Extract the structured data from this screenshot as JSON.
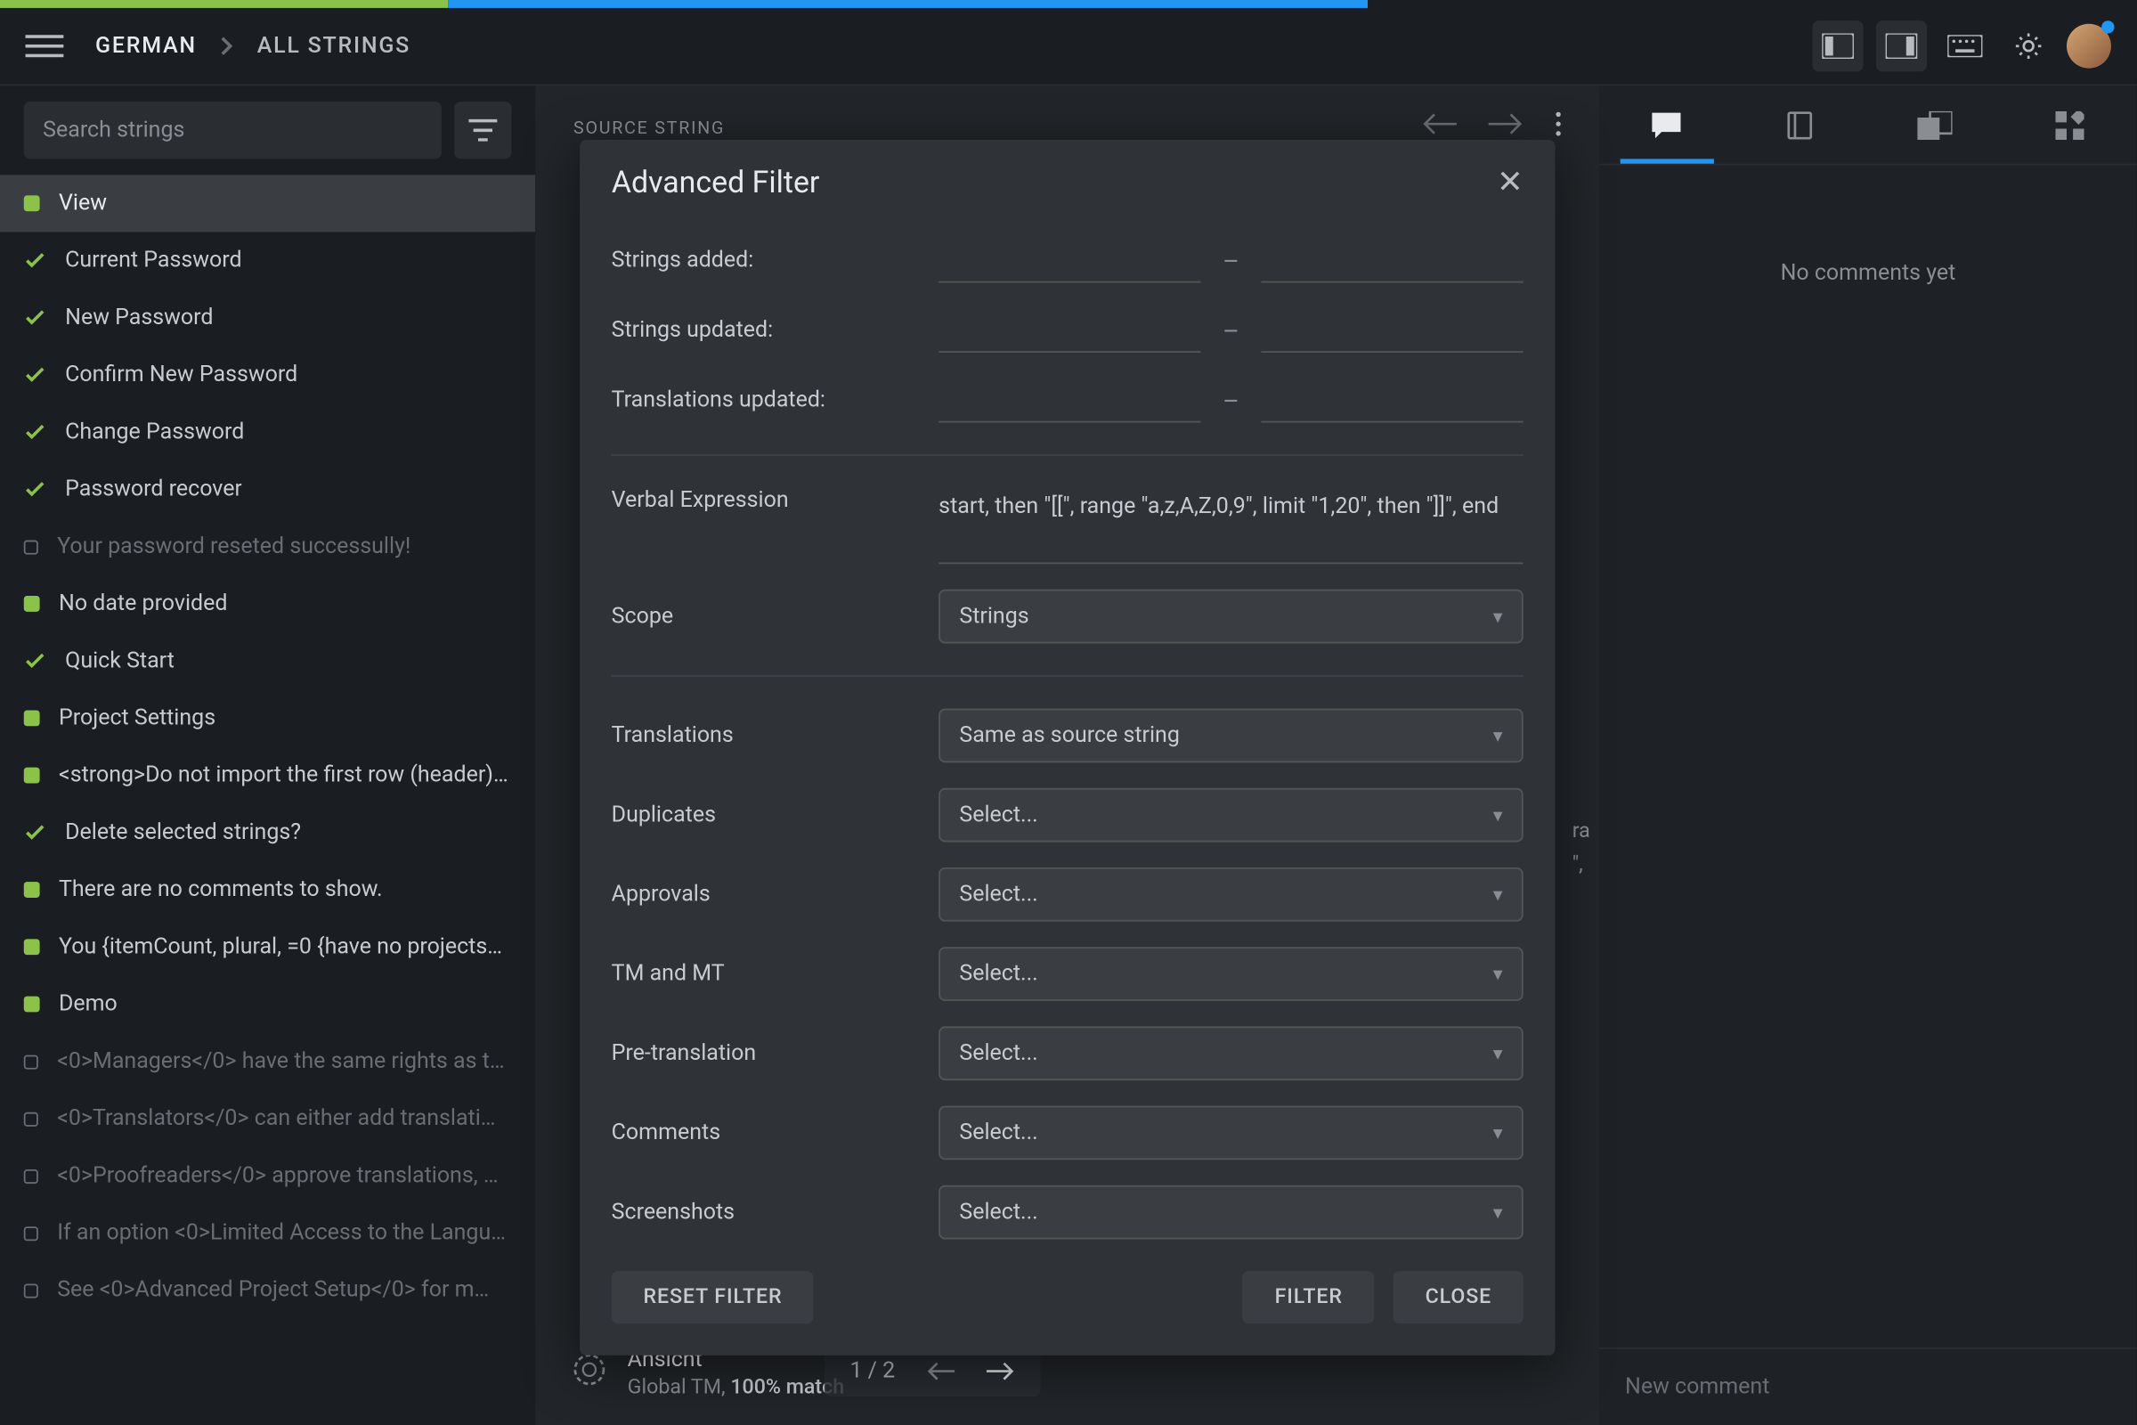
{
  "breadcrumb": {
    "language": "GERMAN",
    "section": "ALL STRINGS"
  },
  "search": {
    "placeholder": "Search strings"
  },
  "strings": [
    {
      "status": "dot-green",
      "label": "View",
      "selected": true
    },
    {
      "status": "check",
      "label": "Current Password"
    },
    {
      "status": "check",
      "label": "New Password"
    },
    {
      "status": "check",
      "label": "Confirm New Password"
    },
    {
      "status": "check",
      "label": "Change Password"
    },
    {
      "status": "check",
      "label": "Password recover"
    },
    {
      "status": "box",
      "label": "Your password reseted successully!",
      "dim": true
    },
    {
      "status": "dot-green",
      "label": "No date provided"
    },
    {
      "status": "check",
      "label": "Quick Start"
    },
    {
      "status": "dot-green",
      "label": "Project Settings"
    },
    {
      "status": "dot-green",
      "label": "<strong>Do not import the first row (header)…"
    },
    {
      "status": "check",
      "label": "Delete selected strings?"
    },
    {
      "status": "dot-green",
      "label": "There are no comments to show."
    },
    {
      "status": "dot-green",
      "label": "You {itemCount, plural, =0 {have no projects…"
    },
    {
      "status": "dot-green",
      "label": "Demo"
    },
    {
      "status": "box",
      "label": "<0>Managers</0> have the same rights as t…",
      "dim": true
    },
    {
      "status": "box",
      "label": "<0>Translators</0> can either add translati…",
      "dim": true
    },
    {
      "status": "box",
      "label": "<0>Proofreaders</0> approve translations, …",
      "dim": true
    },
    {
      "status": "box",
      "label": "If an option <0>Limited Access to the Langu…",
      "dim": true
    },
    {
      "status": "box",
      "label": "See <0>Advanced Project Setup</0> for m…",
      "dim": true
    }
  ],
  "source_string_label": "SOURCE STRING",
  "pager": {
    "text": "1 / 2"
  },
  "modal": {
    "title": "Advanced Filter",
    "strings_added": "Strings added:",
    "strings_updated": "Strings updated:",
    "translations_updated": "Translations updated:",
    "verbal_expression": "Verbal Expression",
    "verbal_value": "start, then \"[[\", range \"a,z,A,Z,0,9\", limit \"1,20\", then \"]]\", end",
    "scope": "Scope",
    "scope_value": "Strings",
    "translations": "Translations",
    "translations_value": "Same as source string",
    "duplicates": "Duplicates",
    "approvals": "Approvals",
    "tm_mt": "TM and MT",
    "pretranslation": "Pre-translation",
    "comments": "Comments",
    "screenshots": "Screenshots",
    "select_placeholder": "Select...",
    "reset": "RESET FILTER",
    "filter": "FILTER",
    "close": "CLOSE"
  },
  "right": {
    "no_comments": "No comments yet",
    "new_comment": "New comment"
  },
  "tm": {
    "title": "Ansicht",
    "prefix": "Global TM, ",
    "match": "100% match"
  }
}
